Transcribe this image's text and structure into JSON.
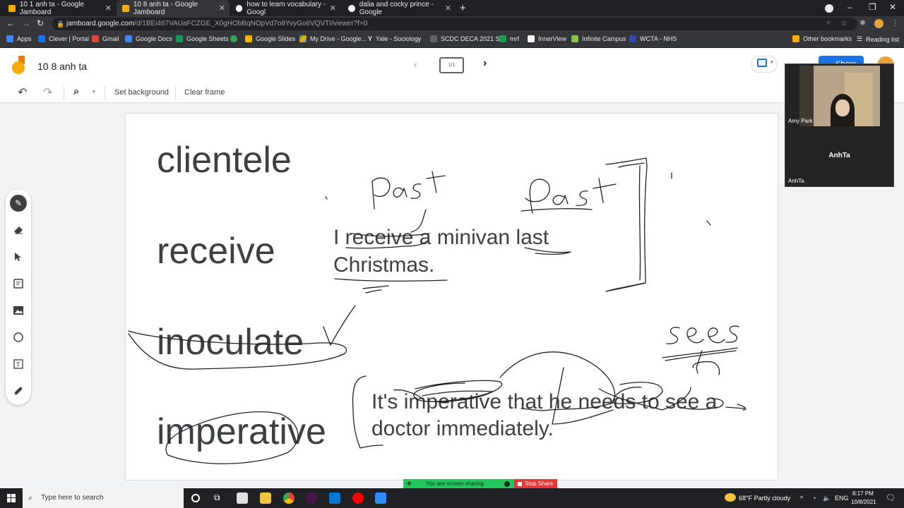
{
  "tabs": [
    {
      "title": "10 1 anh ta - Google Jamboard",
      "icon": "jamboard-icon",
      "color": "#f9ab00"
    },
    {
      "title": "10 8 anh ta - Google Jamboard",
      "icon": "jamboard-icon",
      "color": "#f9ab00"
    },
    {
      "title": "how to learn vocabulary - Googl",
      "icon": "google-icon",
      "color": "#ffffff"
    },
    {
      "title": "dalia and cocky prince - Google",
      "icon": "google-icon",
      "color": "#ffffff"
    }
  ],
  "address": {
    "host": "jamboard.google.com",
    "path": "/d/1BEi467VAUaFCZGE_X0gHObBqNOpVd7o8YvyGo6VQVTI/viewer?f=0"
  },
  "bookmarks": [
    {
      "label": "Apps"
    },
    {
      "label": "Clever | Portal"
    },
    {
      "label": "Gmail"
    },
    {
      "label": "Google Docs"
    },
    {
      "label": "Google Sheets"
    },
    {
      "label": "Google Slides"
    },
    {
      "label": "My Drive - Google..."
    },
    {
      "label": "Yale - Sociology"
    },
    {
      "label": "SCDC DECA 2021 S..."
    },
    {
      "label": "mrf"
    },
    {
      "label": "InnerView"
    },
    {
      "label": "Infinite Campus"
    },
    {
      "label": "WCTA - NHS"
    }
  ],
  "bookmarks_right": {
    "other": "Other bookmarks",
    "reading": "Reading list"
  },
  "jamboard": {
    "title": "10 8 anh ta",
    "frame_counter": "1/1",
    "toolbar": {
      "set_background": "Set background",
      "clear_frame": "Clear frame"
    },
    "share_label": "Share"
  },
  "canvas": {
    "words": [
      "clientele",
      "receive",
      "inoculate",
      "imperative"
    ],
    "sentence1_line1": "I receive a minivan last",
    "sentence1_line2": "Christmas.",
    "sentence2_line1": "It's imperative that he needs to see a",
    "sentence2_line2": "doctor immediately.",
    "handwriting": [
      "Past",
      "Past",
      "sees"
    ]
  },
  "video": {
    "top_name": "Amy Park",
    "center_name": "AnhTa",
    "bottom_name": "AnhTa"
  },
  "screen_share": {
    "status": "You are screen sharing",
    "stop": "Stop Share"
  },
  "taskbar": {
    "search_placeholder": "Type here to search",
    "weather": "68°F  Partly cloudy",
    "lang": "ENG",
    "time": "8:17 PM",
    "date": "10/8/2021"
  }
}
